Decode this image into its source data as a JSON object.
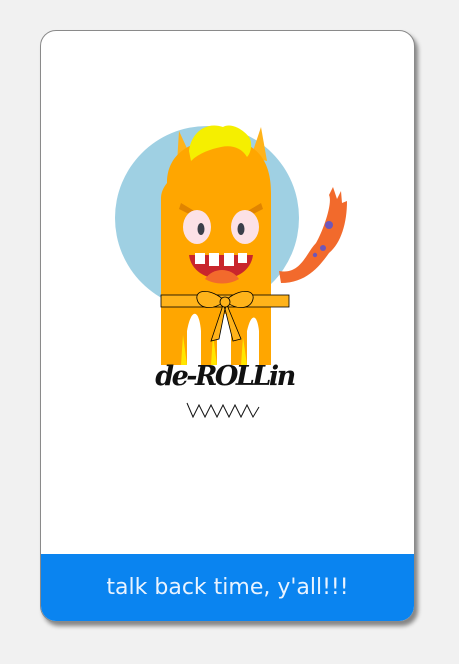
{
  "brand": {
    "name": "de-ROLLin"
  },
  "cta": {
    "label": "talk back time, y'all!!!"
  },
  "colors": {
    "accent": "#0a84f0",
    "circle": "#9fd0e3",
    "monster": "#ffa600",
    "hair": "#f5ef00",
    "tail": "#f26a2c"
  },
  "icons": {
    "mascot": "orange-horned-monster-with-bow",
    "squiggle": "zigzag-underline"
  }
}
